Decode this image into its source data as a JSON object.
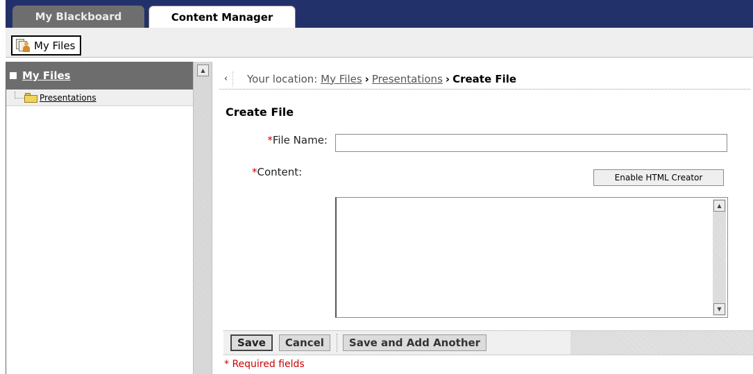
{
  "tabs": [
    {
      "label": "My Blackboard",
      "active": false
    },
    {
      "label": "Content Manager",
      "active": true
    }
  ],
  "subbar": {
    "myfiles_label": "My Files"
  },
  "sidebar": {
    "header": "My Files",
    "tree": [
      {
        "label": "Presentations"
      }
    ]
  },
  "breadcrumb": {
    "prefix": "Your location:",
    "items": [
      "My Files",
      "Presentations"
    ],
    "current": "Create File"
  },
  "form": {
    "title": "Create File",
    "required_marker": "*",
    "file_name_label": "File Name:",
    "file_name_value": "",
    "content_label": "Content:",
    "html_creator_button": "Enable HTML Creator"
  },
  "actions": {
    "save": "Save",
    "cancel": "Cancel",
    "save_add_another": "Save and Add Another"
  },
  "footer": {
    "required_note": "* Required fields"
  },
  "colors": {
    "tab_bar": "#23316b",
    "required": "#cc0000",
    "panel_header": "#6d6d6d"
  }
}
